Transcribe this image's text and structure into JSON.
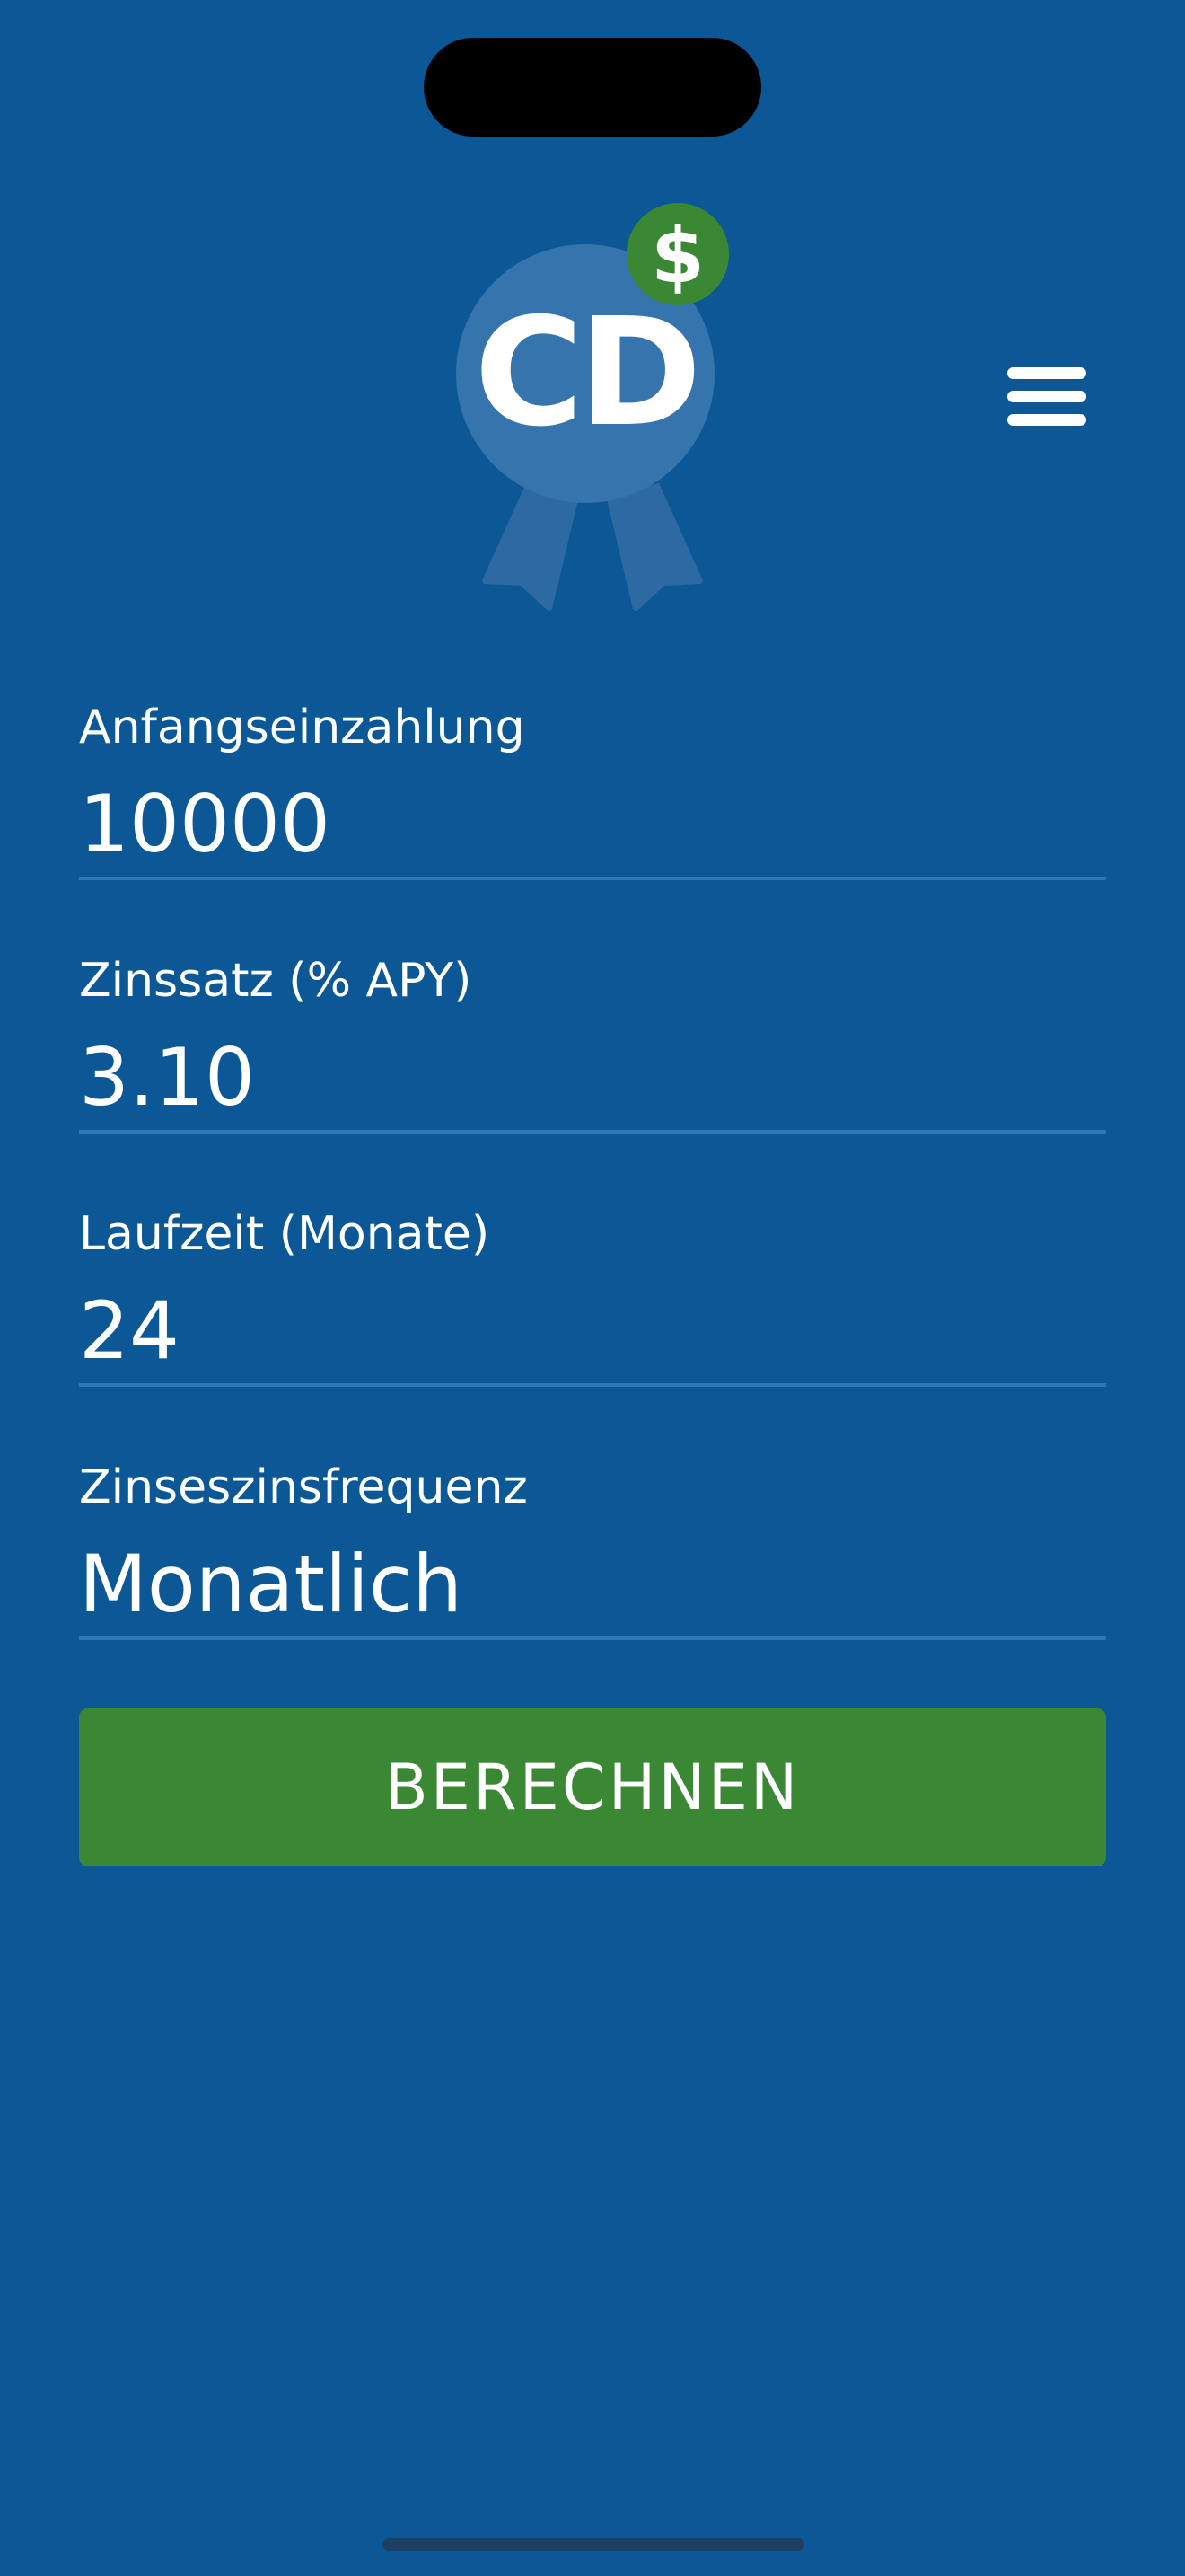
{
  "app": {
    "logo_text": "CD",
    "logo_badge_symbol": "$",
    "menu_icon": "hamburger-menu-icon"
  },
  "form": {
    "initial_deposit": {
      "label": "Anfangseinzahlung",
      "value": "10000"
    },
    "interest_rate": {
      "label": "Zinssatz (% APY)",
      "value": "3.10"
    },
    "term": {
      "label": "Laufzeit (Monate)",
      "value": "24"
    },
    "compound_frequency": {
      "label": "Zinseszinsfrequenz",
      "value": "Monatlich"
    },
    "calculate_button": "BERECHNEN"
  },
  "colors": {
    "background": "#0c5896",
    "button": "#3b8834",
    "badge": "#3b8834",
    "logo_circle": "#3574ad",
    "underline": "#2f78b5",
    "text": "#ffffff"
  }
}
